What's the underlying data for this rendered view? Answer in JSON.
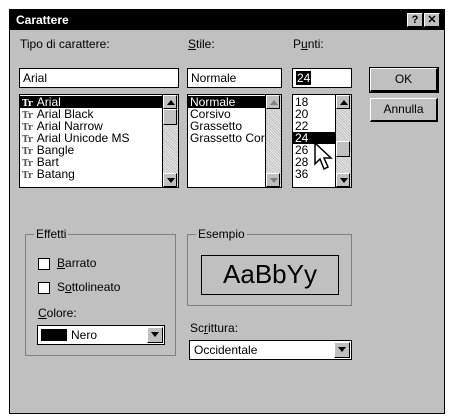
{
  "window": {
    "title": "Carattere",
    "help": "?",
    "close": "✕"
  },
  "font": {
    "label": "Tipo di carattere:",
    "value": "Arial",
    "items": [
      "Arial",
      "Arial Black",
      "Arial Narrow",
      "Arial Unicode MS",
      "Bangle",
      "Bart",
      "Batang"
    ],
    "icon_glyph": "Tr"
  },
  "style": {
    "label": "Stile:",
    "value": "Normale",
    "items": [
      "Normale",
      "Corsivo",
      "Grassetto",
      "Grassetto Corsi"
    ]
  },
  "size": {
    "label": "Punti:",
    "value": "24",
    "items": [
      "18",
      "20",
      "22",
      "24",
      "26",
      "28",
      "36"
    ]
  },
  "buttons": {
    "ok": "OK",
    "cancel": "Annulla"
  },
  "effects": {
    "label": "Effetti",
    "strike": "Barrato",
    "underline": "Sottolineato",
    "color_label": "Colore:",
    "color_value": "Nero",
    "color_swatch": "#000000"
  },
  "sample": {
    "label": "Esempio",
    "text": "AaBbYy"
  },
  "script": {
    "label": "Scrittura:",
    "value": "Occidentale"
  }
}
